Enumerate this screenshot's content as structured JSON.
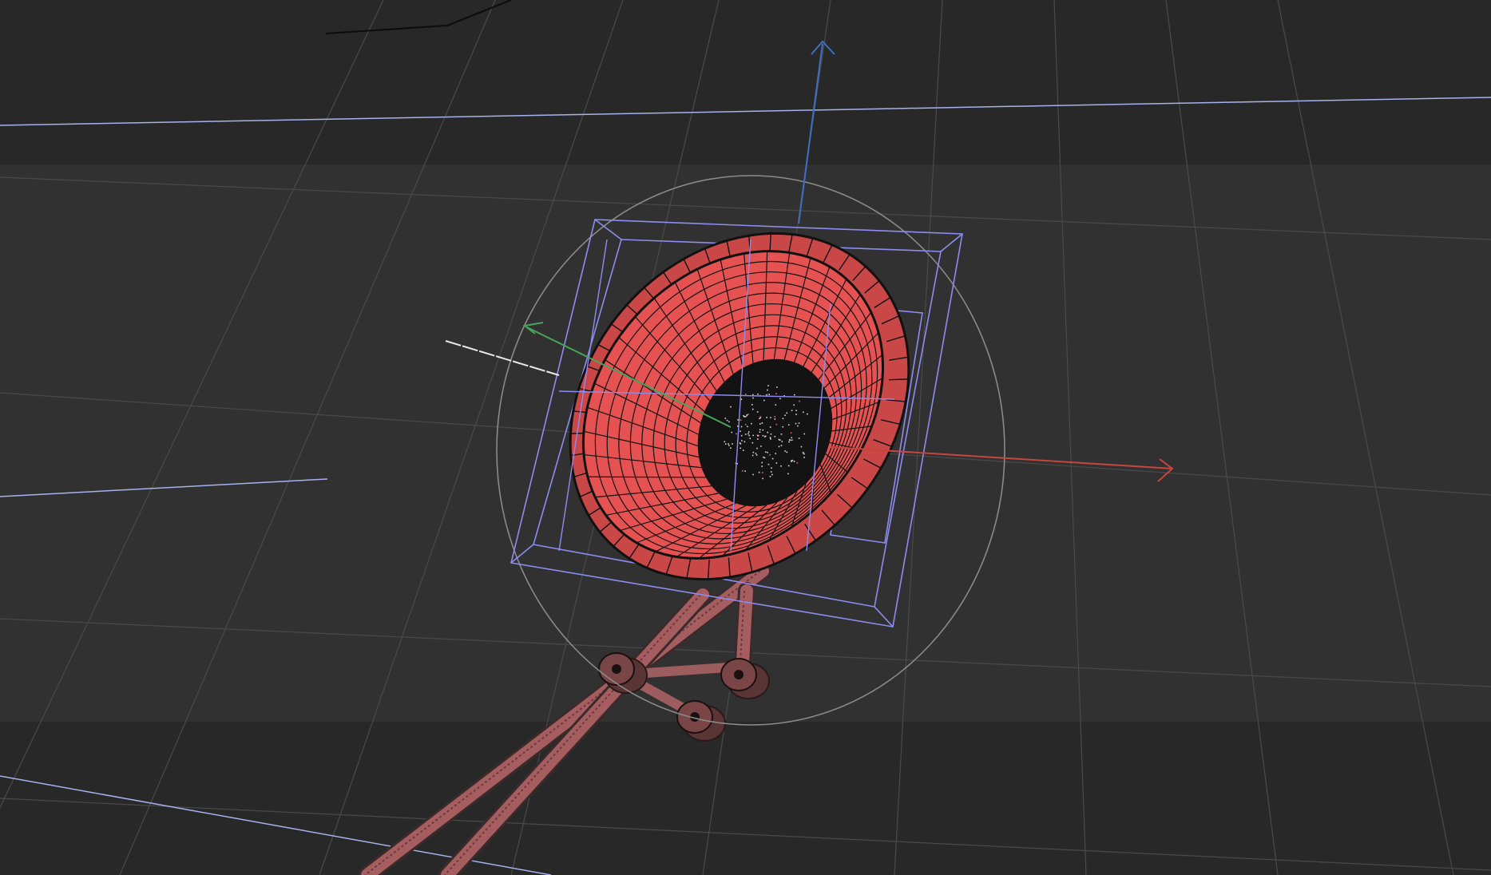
{
  "viewport": {
    "view": "perspective",
    "shading": "wireframe",
    "background": "#282828",
    "safe_frame_fill": "#313131",
    "grid_color": "#4a4a4a",
    "horizon_color": "#a6b2ee",
    "selection_color": "#e65252",
    "mesh_line_color": "#111111",
    "bounding_box_color": "#8e8cf0",
    "gizmo_circle_color": "#8a8a8a",
    "axes": {
      "x": {
        "name": "x-axis",
        "color": "#c6463e"
      },
      "y": {
        "name": "y-axis",
        "color": "#4aa35a"
      },
      "z": {
        "name": "z-axis",
        "color": "#3f6fc4"
      }
    }
  },
  "scene_objects": [
    {
      "name": "speaker-cone",
      "selected": true
    },
    {
      "name": "speaker-frame",
      "selected": true
    },
    {
      "name": "stand-rods",
      "selected": true
    },
    {
      "name": "hinge-cylinders",
      "selected": true
    }
  ]
}
